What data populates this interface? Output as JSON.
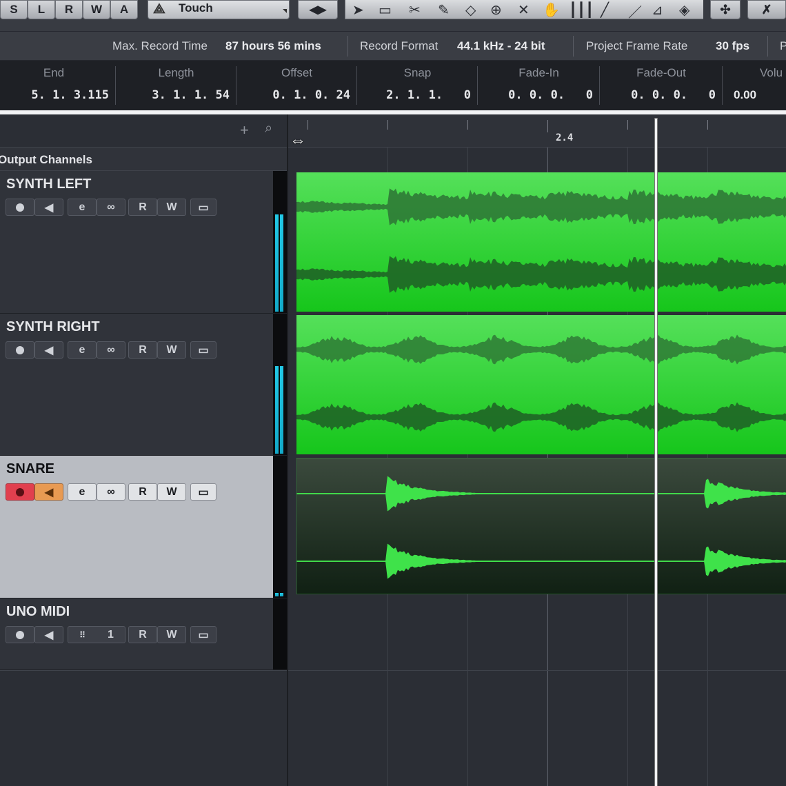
{
  "transport": {
    "solo_label": "S",
    "listen_label": "L",
    "read_label": "R",
    "write_label": "W",
    "auto_label": "A",
    "automation_mode": "Touch"
  },
  "info_line": {
    "max_record_label": "Max. Record Time",
    "max_record_value": "87 hours 56 mins",
    "record_format_label": "Record Format",
    "record_format_value": "44.1 kHz - 24 bit",
    "frame_rate_label": "Project Frame Rate",
    "frame_rate_value": "30 fps",
    "overflow_label": "P"
  },
  "event_info": [
    {
      "label": "End",
      "value": "5. 1. 3.115"
    },
    {
      "label": "Length",
      "value": "3. 1. 1. 54"
    },
    {
      "label": "Offset",
      "value": "0. 1. 0. 24"
    },
    {
      "label": "Snap",
      "value": "2. 1. 1.   0"
    },
    {
      "label": "Fade-In",
      "value": "0. 0. 0.   0"
    },
    {
      "label": "Fade-Out",
      "value": "0. 0. 0.   0"
    },
    {
      "label": "Volu",
      "value": "0.00"
    }
  ],
  "ruler": {
    "bar_label": "2.4"
  },
  "folder": {
    "name": "Output Channels"
  },
  "tracks": [
    {
      "name": "SYNTH LEFT"
    },
    {
      "name": "SYNTH RIGHT"
    },
    {
      "name": "SNARE"
    },
    {
      "name": "UNO MIDI",
      "midi_channel": "1"
    }
  ],
  "colors": {
    "clip_green": "#2fd52f",
    "meter_cyan": "#22c9e6",
    "record_red": "#e13f4e",
    "monitor_orange": "#e89a52"
  }
}
